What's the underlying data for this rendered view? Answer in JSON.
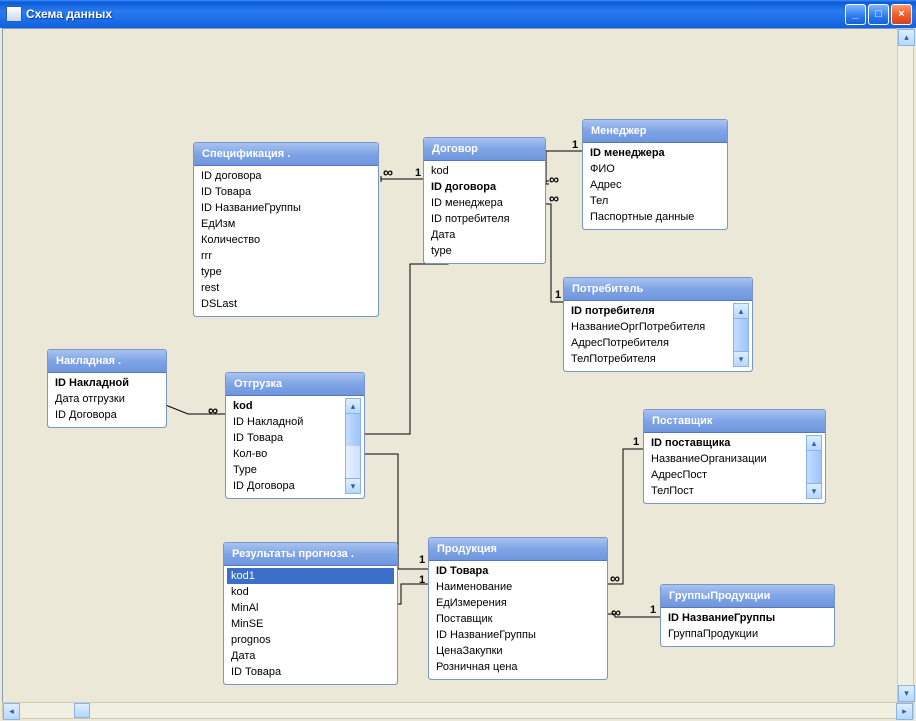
{
  "window": {
    "title": "Схема данных"
  },
  "tables": {
    "spec": {
      "title": "Спецификация .",
      "fields": [
        "ID договора",
        "ID Товара",
        "ID НазваниеГруппы",
        "ЕдИзм",
        "Количество",
        "rrr",
        "type",
        "rest",
        "DSLast"
      ],
      "pk": []
    },
    "dogovor": {
      "title": "Договор",
      "fields": [
        "kod",
        "ID договора",
        "ID менеджера",
        "ID потребителя",
        "Дата",
        "type"
      ],
      "pk": [
        "ID договора"
      ]
    },
    "manager": {
      "title": "Менеджер",
      "fields": [
        "ID менеджера",
        "ФИО",
        "Адрес",
        "Тел",
        "Паспортные данные"
      ],
      "pk": [
        "ID менеджера"
      ]
    },
    "potreb": {
      "title": "Потребитель",
      "fields": [
        "ID потребителя",
        "НазваниеОргПотребителя",
        "АдресПотребителя",
        "ТелПотребителя"
      ],
      "pk": [
        "ID потребителя"
      ]
    },
    "nakladnaya": {
      "title": "Накладная .",
      "fields": [
        "ID Накладной",
        "Дата отгрузки",
        "ID Договора"
      ],
      "pk": [
        "ID Накладной"
      ]
    },
    "otgruzka": {
      "title": "Отгрузка",
      "fields": [
        "kod",
        "ID Накладной",
        "ID Товара",
        "Кол-во",
        "Type",
        "ID Договора"
      ],
      "pk": [
        "kod"
      ]
    },
    "postavshik": {
      "title": "Поставщик",
      "fields": [
        "ID поставщика",
        "НазваниеОрганизации",
        "АдресПост",
        "ТелПост"
      ],
      "pk": [
        "ID поставщика"
      ]
    },
    "prognoz": {
      "title": "Результаты прогноза .",
      "fields": [
        "kod1",
        "kod",
        "MinAl",
        "MinSE",
        "prognos",
        "Дата",
        "ID Товара"
      ],
      "selected": "kod1"
    },
    "product": {
      "title": "Продукция",
      "fields": [
        "ID Товара",
        "Наименование",
        "ЕдИзмерения",
        "Поставщик",
        "ID НазваниеГруппы",
        "ЦенаЗакупки",
        "Розничная цена"
      ],
      "pk": [
        "ID Товара"
      ]
    },
    "group": {
      "title": "ГруппыПродукции",
      "fields": [
        "ID НазваниеГруппы",
        "ГруппаПродукции"
      ],
      "pk": [
        "ID НазваниеГруппы"
      ]
    }
  },
  "relation_symbols": {
    "one": "1",
    "many": "∞"
  },
  "relations": [
    {
      "from": "dogovor",
      "to": "spec",
      "card": [
        "1",
        "∞"
      ]
    },
    {
      "from": "manager",
      "to": "dogovor",
      "card": [
        "1",
        "∞"
      ]
    },
    {
      "from": "potreb",
      "to": "dogovor",
      "card": [
        "1",
        "∞"
      ]
    },
    {
      "from": "nakladnaya",
      "to": "otgruzka",
      "card": [
        "1",
        "∞"
      ]
    },
    {
      "from": "dogovor",
      "to": "otgruzka",
      "card": [
        "1",
        "∞"
      ]
    },
    {
      "from": "product",
      "to": "otgruzka",
      "card": [
        "1",
        "∞"
      ]
    },
    {
      "from": "product",
      "to": "prognoz",
      "card": [
        "1",
        "∞"
      ]
    },
    {
      "from": "group",
      "to": "product",
      "card": [
        "1",
        "∞"
      ]
    },
    {
      "from": "postavshik",
      "to": "product",
      "card": [
        "1",
        "∞"
      ]
    }
  ]
}
